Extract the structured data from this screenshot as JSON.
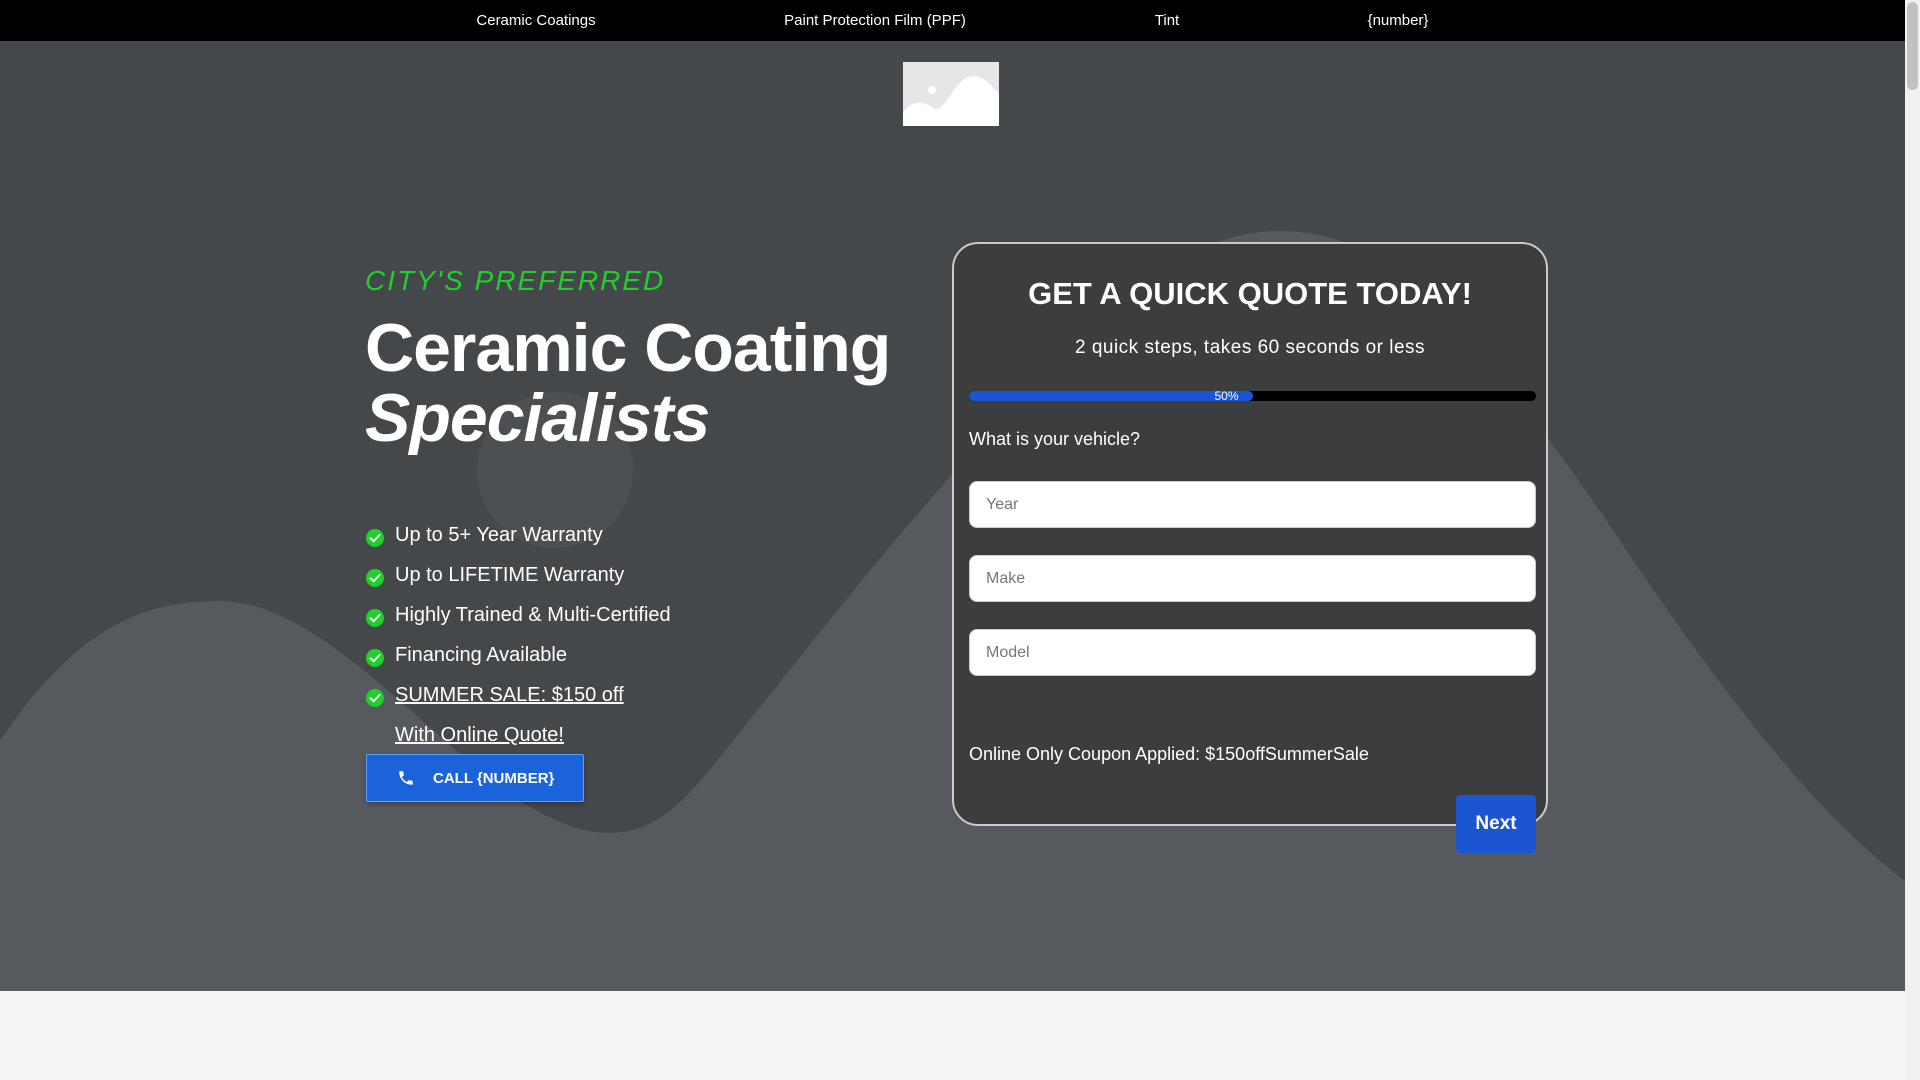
{
  "nav": {
    "items": [
      {
        "label": "Ceramic Coatings"
      },
      {
        "label": "Paint Protection Film (PPF)"
      },
      {
        "label": "Tint"
      },
      {
        "label": "{number}"
      }
    ]
  },
  "hero": {
    "eyebrow": "CITY'S PREFERRED",
    "headline_line1": "Ceramic Coating",
    "headline_line2": "Specialists",
    "features": [
      "Up to 5+ Year Warranty",
      "Up to LIFETIME Warranty",
      "Highly Trained & Multi-Certified",
      "Financing Available",
      "SUMMER SALE: $150 off With Online Quote!"
    ],
    "call_button": "CALL {NUMBER}"
  },
  "quote_form": {
    "title": "GET A QUICK QUOTE TODAY!",
    "subtitle": "2 quick steps, takes 60 seconds or less",
    "progress_percent": 50,
    "progress_label": "50%",
    "question": "What is your vehicle?",
    "fields": {
      "year_placeholder": "Year",
      "make_placeholder": "Make",
      "model_placeholder": "Model"
    },
    "coupon_text": "Online Only Coupon Applied: $150offSummerSale",
    "next_button": "Next"
  },
  "colors": {
    "accent_green": "#1fcf2a",
    "button_blue": "#1b63db",
    "hero_bg": "#45484b",
    "card_bg": "#3b3d3e"
  },
  "icons": [
    "image-placeholder-icon",
    "check-circle-icon",
    "phone-icon"
  ]
}
